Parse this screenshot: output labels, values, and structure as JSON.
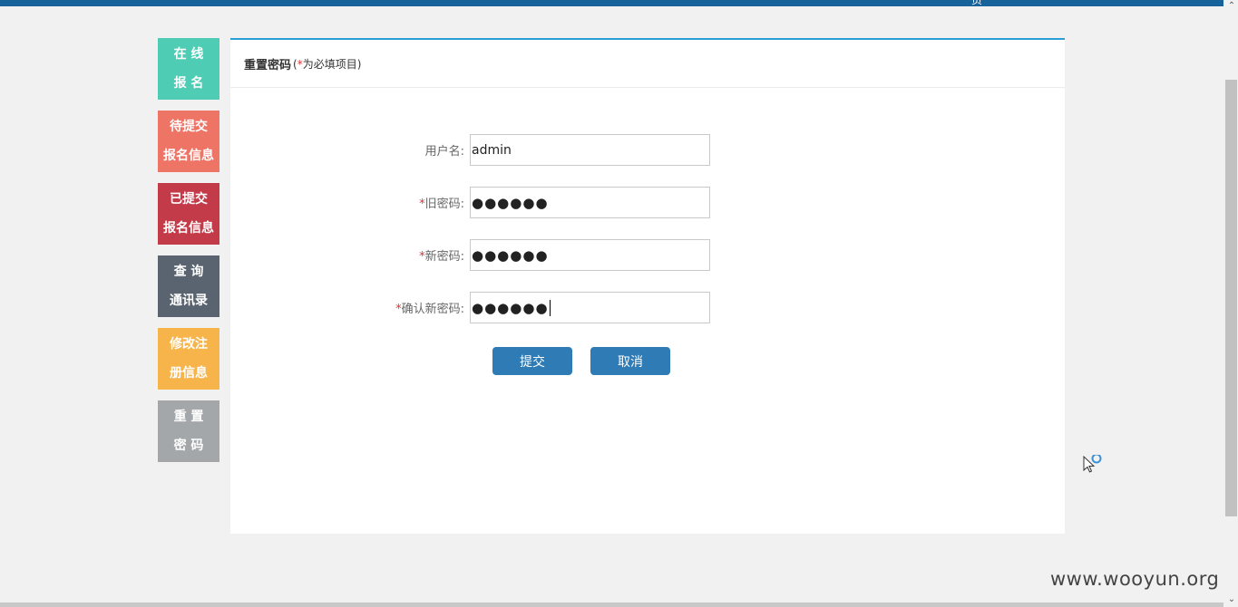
{
  "top_glyph": "页",
  "nav": [
    {
      "line1": "在 线",
      "line2": "报 名",
      "color": "#4ecdb4"
    },
    {
      "line1": "待提交",
      "line2": "报名信息",
      "color": "#ee7466"
    },
    {
      "line1": "已提交",
      "line2": "报名信息",
      "color": "#c33a48"
    },
    {
      "line1": "查 询",
      "line2": "通讯录",
      "color": "#5a6470"
    },
    {
      "line1": "修改注",
      "line2": "册信息",
      "color": "#f6b44b"
    },
    {
      "line1": "重 置",
      "line2": "密 码",
      "color": "#a3a7aa"
    }
  ],
  "panel": {
    "title": "重置密码",
    "note_open": "(",
    "note_star": "*",
    "note_text": "为必填项目)"
  },
  "form": {
    "username": {
      "label": "用户名:",
      "value": "admin"
    },
    "old_password": {
      "star": "*",
      "label": "旧密码:",
      "value": "●●●●●●"
    },
    "new_password": {
      "star": "*",
      "label": "新密码:",
      "value": "●●●●●●"
    },
    "confirm_password": {
      "star": "*",
      "label": "确认新密码:",
      "value": "●●●●●●"
    }
  },
  "buttons": {
    "submit": "提交",
    "cancel": "取消"
  },
  "watermark": "www.wooyun.org",
  "colors": {
    "accent": "#2a9fd6",
    "button": "#2e7bb5",
    "top_bar": "#17629a"
  }
}
